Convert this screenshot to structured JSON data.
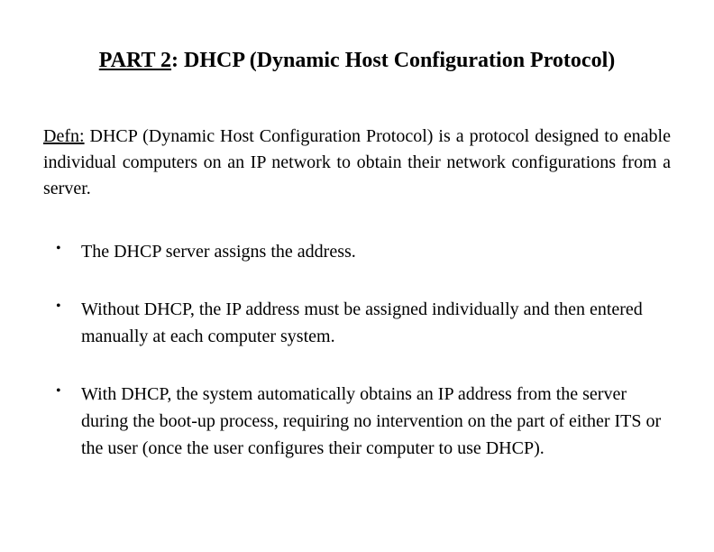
{
  "title": {
    "underlined": "PART 2",
    "rest": ": DHCP (Dynamic Host Configuration Protocol)"
  },
  "definition": {
    "label": "Defn:",
    "text": " DHCP (Dynamic Host Configuration Protocol) is a protocol designed to enable individual computers on an IP network to obtain their network configurations from a server."
  },
  "bullets": [
    "The DHCP server assigns the address.",
    "Without DHCP, the IP address must be assigned individually and then entered manually at each computer system.",
    "With DHCP, the system automatically obtains an IP address from the server during the boot-up process, requiring no intervention on the part of either ITS or the user (once the user configures their computer to use DHCP)."
  ]
}
